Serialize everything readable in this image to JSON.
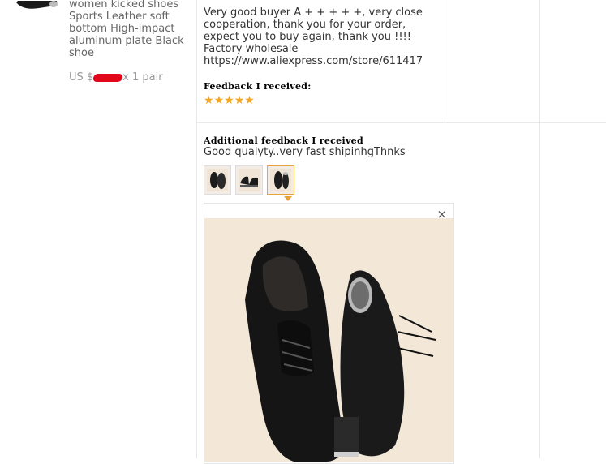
{
  "product": {
    "title": "women kicked shoes Sports Leather soft bottom High-impact aluminum plate Black shoe",
    "price_prefix": "US $",
    "quantity": "x 1 pair"
  },
  "feedback": {
    "seller_text": "Very good buyer A + + + + +, very close cooperation, thank you for your order, expect you to buy again, thank you !!!! Factory wholesale https://www.aliexpress.com/store/611417",
    "received_label": "Feedback I received:",
    "rating": 5,
    "star_glyph": "★",
    "additional_label": "Additional feedback I received",
    "additional_text": "Good qualyty..very fast shipinhgThnks"
  },
  "photos": {
    "thumbnails": [
      "photo-1",
      "photo-2",
      "photo-3"
    ],
    "active_index": 2,
    "close_glyph": "×"
  },
  "colors": {
    "star": "#f5a623",
    "active_border": "#e6a23c",
    "redaction": "#e2071b"
  }
}
